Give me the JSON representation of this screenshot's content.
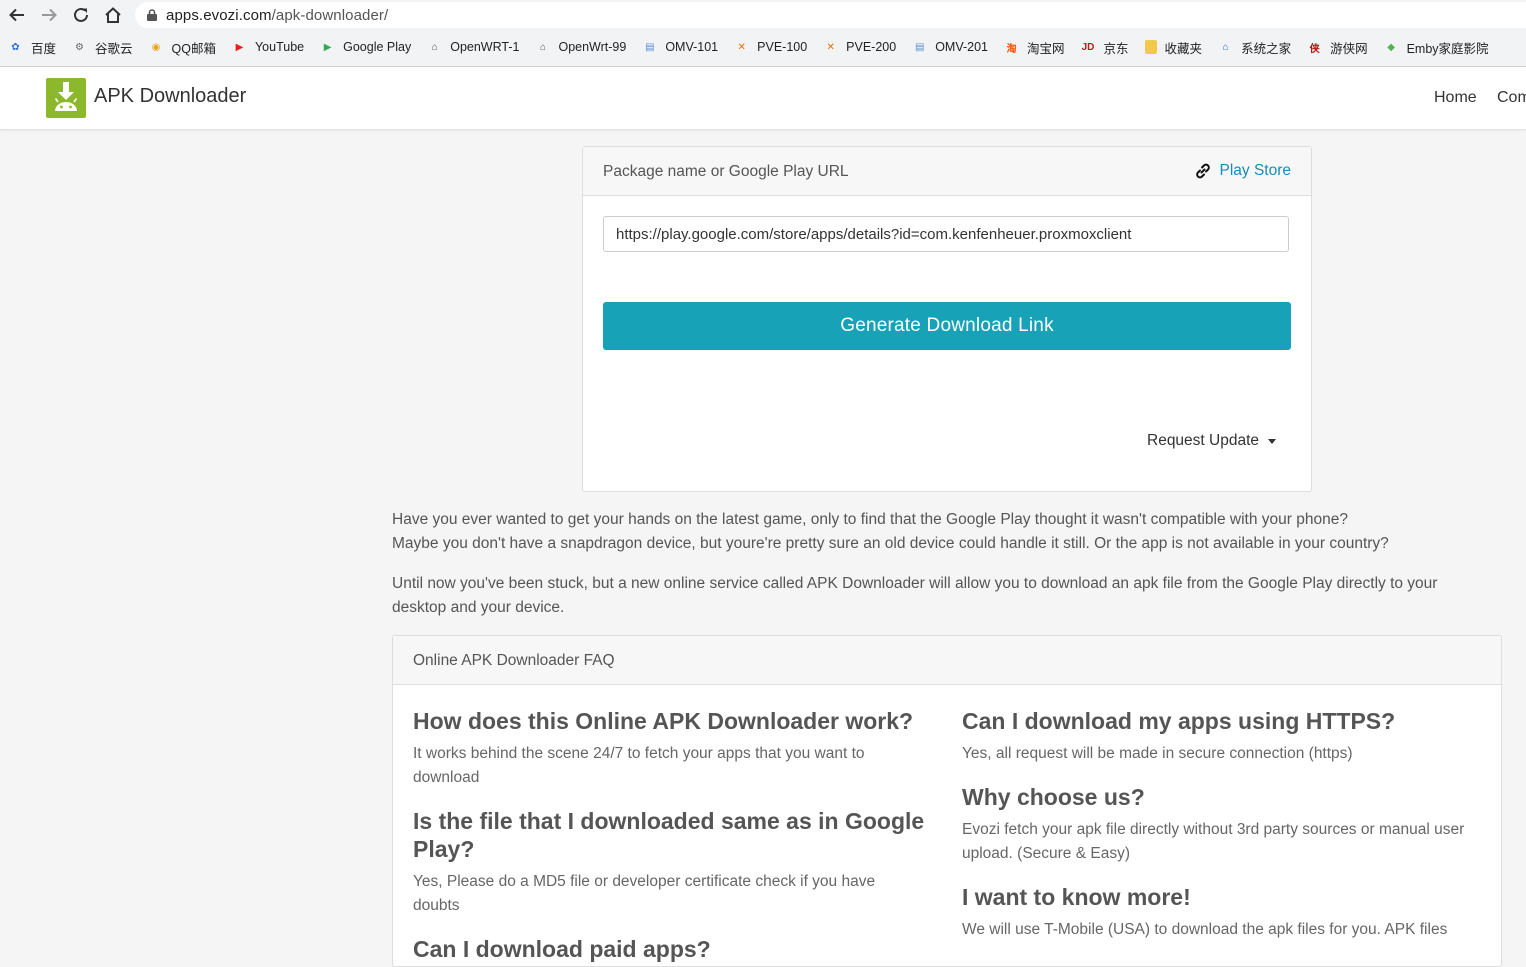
{
  "browser": {
    "url_host": "apps.evozi.com",
    "url_path": "/apk-downloader/",
    "bookmarks": [
      {
        "label": "百度",
        "icon": "baidu-icon",
        "color": "#2f6fdc",
        "glyph": "✿"
      },
      {
        "label": "谷歌云",
        "icon": "gear-icon",
        "color": "#666666",
        "glyph": "⚙"
      },
      {
        "label": "QQ邮箱",
        "icon": "qq-mail-icon",
        "color": "#e9a21c",
        "glyph": "◉"
      },
      {
        "label": "YouTube",
        "icon": "youtube-icon",
        "color": "#e62117",
        "glyph": "▶"
      },
      {
        "label": "Google Play",
        "icon": "google-play-icon",
        "color": "#34a853",
        "glyph": "▶"
      },
      {
        "label": "OpenWRT-1",
        "icon": "openwrt-icon",
        "color": "#555555",
        "glyph": "⌂"
      },
      {
        "label": "OpenWrt-99",
        "icon": "openwrt-icon",
        "color": "#555555",
        "glyph": "⌂"
      },
      {
        "label": "OMV-101",
        "icon": "omv-icon",
        "color": "#5a8fd0",
        "glyph": "▤"
      },
      {
        "label": "PVE-100",
        "icon": "proxmox-icon",
        "color": "#e57000",
        "glyph": "✕"
      },
      {
        "label": "PVE-200",
        "icon": "proxmox-icon",
        "color": "#e57000",
        "glyph": "✕"
      },
      {
        "label": "OMV-201",
        "icon": "omv-icon",
        "color": "#5a8fd0",
        "glyph": "▤"
      },
      {
        "label": "淘宝网",
        "icon": "taobao-icon",
        "color": "#ff5000",
        "glyph": "淘"
      },
      {
        "label": "京东",
        "icon": "jd-icon",
        "color": "#c4161c",
        "glyph": "JD"
      },
      {
        "label": "收藏夹",
        "icon": "folder-icon",
        "color": "#f2c94c",
        "glyph": ""
      },
      {
        "label": "系统之家",
        "icon": "xitongzhijia-icon",
        "color": "#1f6fc5",
        "glyph": "⌂"
      },
      {
        "label": "游侠网",
        "icon": "youxia-icon",
        "color": "#b3120f",
        "glyph": "侠"
      },
      {
        "label": "Emby家庭影院",
        "icon": "emby-icon",
        "color": "#52b54b",
        "glyph": "◆"
      }
    ]
  },
  "site": {
    "brand": "APK Downloader",
    "nav": [
      "Home",
      "Com"
    ]
  },
  "downloader": {
    "header_label": "Package name or Google Play URL",
    "play_store_link": "Play Store",
    "input_value": "https://play.google.com/store/apps/details?id=com.kenfenheuer.proxmoxclient",
    "generate_button": "Generate Download Link",
    "request_update": "Request Update"
  },
  "intro": {
    "line1": "Have you ever wanted to get your hands on the latest game, only to find that the Google Play thought it wasn't compatible with your phone?",
    "line2": "Maybe you don't have a snapdragon device, but youre're pretty sure an old device could handle it still. Or the app is not available in your country?",
    "para2_line1": "Until now you've been stuck, but a new online service called APK Downloader will allow you to download an apk file from the Google Play directly to your",
    "para2_line2": "desktop and your device."
  },
  "faq": {
    "title": "Online APK Downloader FAQ",
    "items": [
      {
        "q": "How does this Online APK Downloader work?",
        "a1": "It works behind the scene 24/7 to fetch your apps that you want to",
        "a2": "download"
      },
      {
        "q1": "Is the file that I downloaded same as in Google",
        "q2": "Play?",
        "a1": "Yes, Please do a MD5 file or developer certificate check if you have",
        "a2": "doubts"
      },
      {
        "q": "Can I download paid apps?"
      },
      {
        "q": "Can I download my apps using HTTPS?",
        "a": "Yes, all request will be made in secure connection (https)"
      },
      {
        "q": "Why choose us?",
        "a1": "Evozi fetch your apk file directly without 3rd party sources or manual user",
        "a2": "upload. (Secure & Easy)"
      },
      {
        "q": "I want to know more!",
        "a": "We will use T-Mobile (USA) to download the apk files for you. APK files"
      }
    ]
  }
}
